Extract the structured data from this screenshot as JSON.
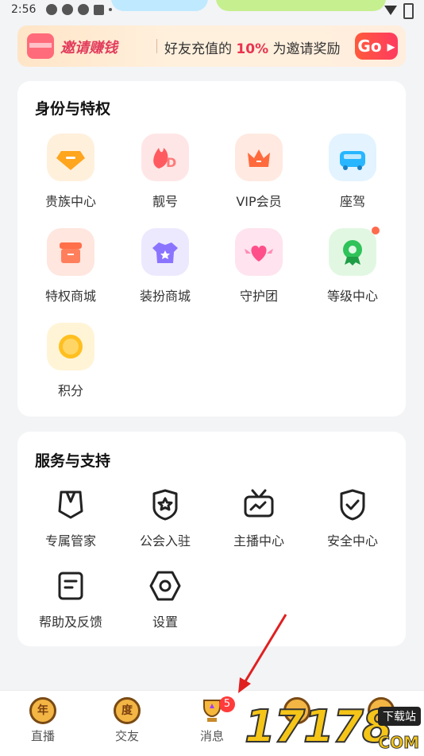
{
  "status_bar": {
    "time": "2:56"
  },
  "banner": {
    "title": "邀请赚钱",
    "desc_prefix": "好友充值的 ",
    "desc_highlight": "10%",
    "desc_suffix": " 为邀请奖励",
    "go_label": "Go ▸"
  },
  "privileges": {
    "title": "身份与特权",
    "items": [
      {
        "label": "贵族中心",
        "icon": "gem-icon"
      },
      {
        "label": "靓号",
        "icon": "flame-id-icon"
      },
      {
        "label": "VIP会员",
        "icon": "crown-icon"
      },
      {
        "label": "座驾",
        "icon": "car-icon"
      },
      {
        "label": "特权商城",
        "icon": "shop-icon"
      },
      {
        "label": "装扮商城",
        "icon": "tshirt-icon"
      },
      {
        "label": "守护团",
        "icon": "heart-wings-icon"
      },
      {
        "label": "等级中心",
        "icon": "medal-icon"
      },
      {
        "label": "积分",
        "icon": "coin-icon"
      }
    ]
  },
  "services": {
    "title": "服务与支持",
    "items": [
      {
        "label": "专属管家",
        "icon": "butler-icon"
      },
      {
        "label": "公会入驻",
        "icon": "guild-shield-icon"
      },
      {
        "label": "主播中心",
        "icon": "tv-icon"
      },
      {
        "label": "安全中心",
        "icon": "shield-check-icon"
      },
      {
        "label": "帮助及反馈",
        "icon": "document-icon"
      },
      {
        "label": "设置",
        "icon": "hexagon-settings-icon"
      }
    ]
  },
  "bottom_nav": {
    "items": [
      {
        "label": "直播",
        "glyph": "年"
      },
      {
        "label": "交友",
        "glyph": "度"
      },
      {
        "label": "消息",
        "badge": "5"
      }
    ]
  },
  "watermark": {
    "big": "17178",
    "small": "下载站",
    "sub": "COM"
  },
  "colors": {
    "accent": "#ff3b5f",
    "highlight": "#e9344f",
    "nav_badge": "#ff3b3b"
  }
}
